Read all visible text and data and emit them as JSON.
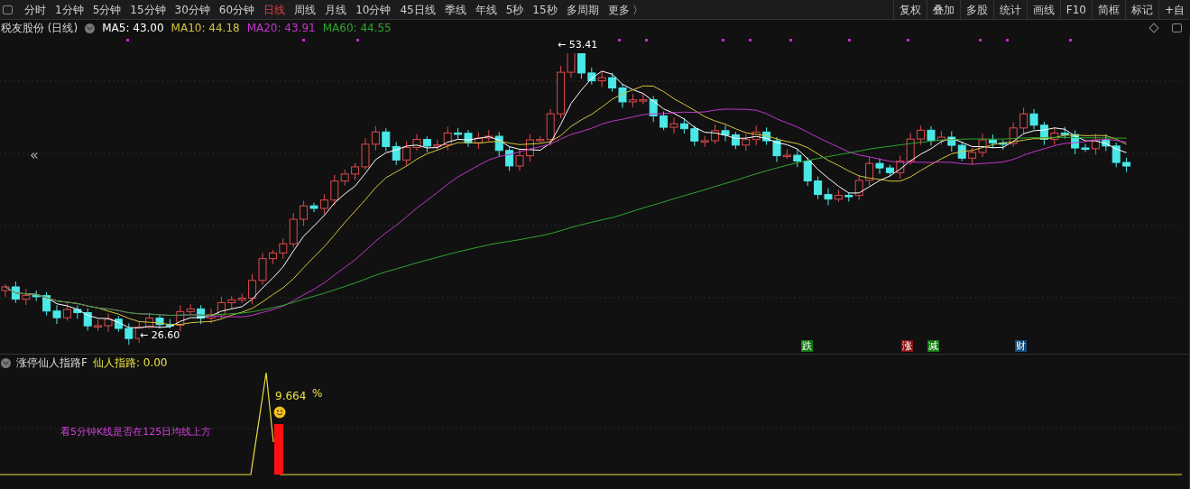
{
  "toolbar": {
    "periods": [
      {
        "label": "分时",
        "selected": false
      },
      {
        "label": "1分钟",
        "selected": false
      },
      {
        "label": "5分钟",
        "selected": false
      },
      {
        "label": "15分钟",
        "selected": false
      },
      {
        "label": "30分钟",
        "selected": false
      },
      {
        "label": "60分钟",
        "selected": false
      },
      {
        "label": "日线",
        "selected": true
      },
      {
        "label": "周线",
        "selected": false
      },
      {
        "label": "月线",
        "selected": false
      },
      {
        "label": "10分钟",
        "selected": false
      },
      {
        "label": "45日线",
        "selected": false
      },
      {
        "label": "季线",
        "selected": false
      },
      {
        "label": "年线",
        "selected": false
      },
      {
        "label": "5秒",
        "selected": false
      },
      {
        "label": "15秒",
        "selected": false
      },
      {
        "label": "多周期",
        "selected": false
      },
      {
        "label": "更多 〉",
        "selected": false
      }
    ],
    "tools": [
      "复权",
      "叠加",
      "多股",
      "统计",
      "画线",
      "F10",
      "简框",
      "标记",
      "+自"
    ]
  },
  "main_chart": {
    "title": "税友股份 (日线)",
    "moving_averages": [
      {
        "label": "MA5: 43.00",
        "color": "#ffffff"
      },
      {
        "label": "MA10: 44.18",
        "color": "#d6c43a"
      },
      {
        "label": "MA20: 43.91",
        "color": "#c037c8"
      },
      {
        "label": "MA60: 44.55",
        "color": "#2fa52f"
      }
    ],
    "collapse": "«",
    "high_label": "← 53.41",
    "low_label": "← 26.60",
    "events": [
      {
        "label": "跌",
        "color": "#117a11"
      },
      {
        "label": "涨",
        "color": "#8a1414"
      },
      {
        "label": "减",
        "color": "#117a11"
      },
      {
        "label": "财",
        "color": "#124a7a"
      }
    ]
  },
  "indicator": {
    "name": "涨停仙人指路F",
    "value": "仙人指路: 0.00",
    "peak_value": "9.664",
    "unit": "%",
    "note": "看5分钟K线是否在125日均线上方"
  }
}
